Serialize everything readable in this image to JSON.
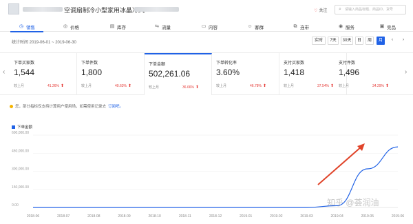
{
  "header": {
    "product_title": "空调扇制冷小型家用冰晶冷风",
    "follow_label": "关注",
    "search_placeholder": "请输入商品标题、商品ID、货号"
  },
  "nav": {
    "tabs": [
      {
        "label": "销售",
        "icon": "sales-icon",
        "active": true
      },
      {
        "label": "价格",
        "icon": "price-icon",
        "active": false
      },
      {
        "label": "库存",
        "icon": "inventory-icon",
        "active": false
      },
      {
        "label": "流量",
        "icon": "traffic-icon",
        "active": false
      },
      {
        "label": "内容",
        "icon": "content-icon",
        "active": false
      },
      {
        "label": "客群",
        "icon": "audience-icon",
        "active": false
      },
      {
        "label": "连带",
        "icon": "related-icon",
        "active": false
      },
      {
        "label": "服务",
        "icon": "service-icon",
        "active": false
      },
      {
        "label": "竞品",
        "icon": "competitor-icon",
        "active": false
      }
    ]
  },
  "filter": {
    "period_label": "统计时间 2019-06-01 ~ 2019-06-30",
    "buttons": [
      "实时",
      "7天",
      "30天",
      "日",
      "周",
      "月"
    ],
    "active_button": "月"
  },
  "metrics": [
    {
      "label": "下单买家数",
      "value": "1,544",
      "compare_label": "较上月",
      "change": "41.26%"
    },
    {
      "label": "下单件数",
      "value": "1,800",
      "compare_label": "较上月",
      "change": "40.63%"
    },
    {
      "label": "下单金额",
      "value": "502,261.06",
      "compare_label": "较上月",
      "change": "36.66%"
    },
    {
      "label": "下单转化率",
      "value": "3.60%",
      "compare_label": "较上月",
      "change": "46.78%"
    },
    {
      "label": "支付买家数",
      "value": "1,418",
      "compare_label": "较上月",
      "change": "37.54%"
    },
    {
      "label": "支付件数",
      "value": "1,496",
      "compare_label": "较上月",
      "change": "34.29%"
    }
  ],
  "notice": {
    "text": "您，部分指标仅支持计算用户使用场，如需使用记录去",
    "link": "订阅吧。"
  },
  "colors": {
    "accent": "#2062e6",
    "up": "#e53935",
    "annotation_arrow": "#e0442a"
  },
  "watermark": "知乎 @荟润油",
  "chart_data": {
    "type": "line",
    "legend": "下单金额",
    "x": [
      "2018-06",
      "2018-07",
      "2018-08",
      "2018-09",
      "2018-10",
      "2018-11",
      "2018-12",
      "2019-01",
      "2019-02",
      "2019-03",
      "2019-04",
      "2019-05",
      "2019-06"
    ],
    "series": [
      {
        "name": "下单金额",
        "values": [
          0,
          0,
          0,
          0,
          0,
          0,
          0,
          0,
          0,
          0,
          15000,
          320000,
          502261.06
        ]
      }
    ],
    "y_ticks": [
      "0.00",
      "150,000.00",
      "300,000.00",
      "450,000.00",
      "600,000.00"
    ],
    "ylim": [
      0,
      600000
    ],
    "grid": true,
    "legend_position": "top-left"
  }
}
